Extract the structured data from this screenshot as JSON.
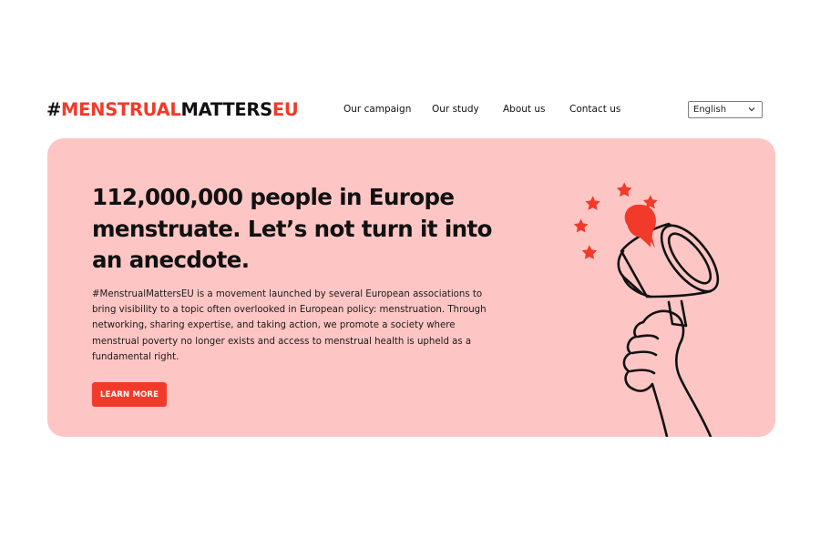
{
  "header": {
    "logo": {
      "hash": "#",
      "word1": "MENSTRUAL",
      "word2": "MATTERS",
      "word3": "EU"
    },
    "nav": [
      {
        "label": "Our campaign"
      },
      {
        "label": "Our study"
      },
      {
        "label": "About us"
      },
      {
        "label": "Contact us"
      }
    ],
    "language_select": {
      "value": "English",
      "icon": "chevron-down-icon"
    }
  },
  "hero": {
    "title": "112,000,000 people in Europe menstruate. Let’s not turn it into an anecdote.",
    "description": "#MenstrualMattersEU is a movement launched by several European associations to bring visibility to a topic often overlooked in European policy: menstruation. Through networking, sharing expertise, and taking action, we promote a society where menstrual poverty no longer exists and access to menstrual health is upheld as a fundamental right.",
    "cta_label": "LEARN MORE",
    "illustration": "megaphone-icon"
  },
  "colors": {
    "accent": "#f23a2a",
    "hero_background": "#fdc6c5",
    "text": "#111111"
  }
}
